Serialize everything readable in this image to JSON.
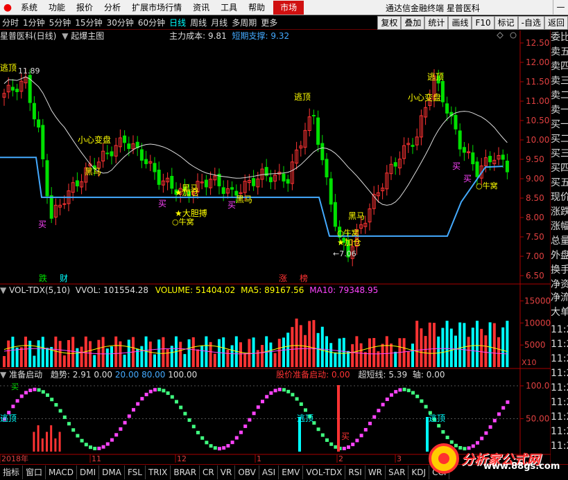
{
  "menu": {
    "items": [
      "系统",
      "功能",
      "报价",
      "分析",
      "扩展市场行情",
      "资讯",
      "工具",
      "帮助"
    ],
    "market_tab": "市场",
    "app_title": "通达信金融终端",
    "stock_name": "星普医科",
    "window_ctrl": "—"
  },
  "periods": [
    "分时",
    "1分钟",
    "5分钟",
    "15分钟",
    "30分钟",
    "60分钟",
    "日线",
    "周线",
    "月线",
    "多周期",
    "更多"
  ],
  "active_period": "日线",
  "right_tabs": [
    "复权",
    "叠加",
    "统计",
    "画线",
    "F10",
    "标记",
    "-自选",
    "返回"
  ],
  "main_panel": {
    "title": "星普医科(日线)",
    "indicator": "起爆主图",
    "cost_label": "主力成本:",
    "cost_value": "9.81",
    "support_label": "短期支撑:",
    "support_value": "9.32",
    "high_label": "11.89",
    "low_label": "7.06",
    "price_ticks": [
      "12.50",
      "12.00",
      "11.50",
      "11.00",
      "10.50",
      "10.00",
      "9.50",
      "9.00",
      "8.50",
      "8.00",
      "7.50",
      "7.00",
      "6.50"
    ],
    "annotations": {
      "escape": "逃顶",
      "careful": "小心变盘",
      "darkhorse": "黑马",
      "buy": "买",
      "add": "加仓",
      "bold": "大胆搏",
      "nest": "牛窝",
      "fall": "跌",
      "finance": "财",
      "rise": "涨",
      "list": "榜"
    }
  },
  "vol_panel": {
    "title": "VOL-TDX(5,10)",
    "vvol_label": "VVOL:",
    "vvol_value": "101554.28",
    "volume_label": "VOLUME:",
    "volume_value": "51404.02",
    "ma5_label": "MA5:",
    "ma5_value": "89167.56",
    "ma10_label": "MA10:",
    "ma10_value": "79348.95",
    "ticks": [
      "15000",
      "10000",
      "5000"
    ],
    "unit": "X10"
  },
  "osc_panel": {
    "title": "准备启动",
    "trend_label": "趋势:",
    "trend_value": "2.91",
    "levels": [
      "0.00",
      "20.00",
      "80.00",
      "100.00"
    ],
    "prepare_label": "股价准备启动:",
    "prepare_value": "0.00",
    "overbought_label": "超短线:",
    "overbought_value": "5.39",
    "axis_label": "轴:",
    "axis_value": "0.00",
    "ticks": [
      "100.0",
      "50.00"
    ],
    "escape": "逃顶",
    "buy": "买"
  },
  "time_axis": [
    "2018年",
    "11",
    "12",
    "1",
    "2",
    "3"
  ],
  "side_quotes": [
    "委比",
    "卖五",
    "卖四",
    "卖三",
    "卖二",
    "卖一",
    "买一",
    "买二",
    "买三",
    "买四",
    "买五",
    "现价",
    "涨跌",
    "涨幅",
    "总量",
    "外盘",
    "换手",
    "净资",
    "收益",
    "",
    "净流",
    "大单"
  ],
  "side_times": [
    "11:2",
    "11:2",
    "11:2",
    "11:2",
    "11:2",
    "11:2",
    "11:2",
    "11:2",
    "11:2",
    "11:2"
  ],
  "bottom_tabs": [
    "指标",
    "窗口",
    "MACD",
    "DMI",
    "DMA",
    "FSL",
    "TRIX",
    "BRAR",
    "CR",
    "VR",
    "OBV",
    "ASI",
    "EMV",
    "VOL-TDX",
    "RSI",
    "WR",
    "SAR",
    "KDJ",
    "CCI"
  ],
  "watermark": {
    "text": "分析家公式网",
    "url": "www.88gs.com"
  },
  "colors": {
    "up": "#ff3333",
    "down": "#00e000",
    "ma_white": "#dddddd",
    "support": "#44aaff",
    "yellow": "#ffff00",
    "cyan": "#00ffff",
    "magenta": "#ff44ff"
  }
}
